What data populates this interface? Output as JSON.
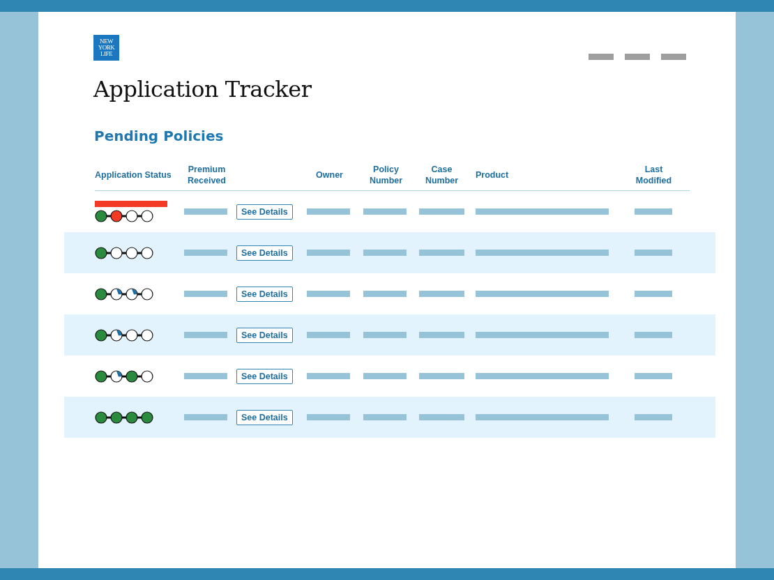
{
  "logo": {
    "lines": [
      "NEW",
      "YORK",
      "LIFE"
    ]
  },
  "title": "Application Tracker",
  "section": "Pending Policies",
  "table": {
    "columns": [
      "Application Status",
      "Premium Received",
      "",
      "Owner",
      "Policy Number",
      "Case Number",
      "Product",
      "Last Modified"
    ],
    "rows": [
      {
        "alert": true,
        "steps": [
          {
            "kind": "done"
          },
          {
            "kind": "error"
          },
          {
            "kind": "pending"
          },
          {
            "kind": "pending"
          }
        ],
        "button": "See Details"
      },
      {
        "alert": false,
        "steps": [
          {
            "kind": "done"
          },
          {
            "kind": "pending"
          },
          {
            "kind": "pending"
          },
          {
            "kind": "pending"
          }
        ],
        "button": "See Details"
      },
      {
        "alert": false,
        "steps": [
          {
            "kind": "done"
          },
          {
            "kind": "partial"
          },
          {
            "kind": "partial"
          },
          {
            "kind": "pending"
          }
        ],
        "button": "See Details"
      },
      {
        "alert": false,
        "steps": [
          {
            "kind": "done"
          },
          {
            "kind": "partial"
          },
          {
            "kind": "pending"
          },
          {
            "kind": "pending"
          }
        ],
        "button": "See Details"
      },
      {
        "alert": false,
        "steps": [
          {
            "kind": "done"
          },
          {
            "kind": "partial"
          },
          {
            "kind": "done"
          },
          {
            "kind": "pending"
          }
        ],
        "button": "See Details"
      },
      {
        "alert": false,
        "steps": [
          {
            "kind": "done"
          },
          {
            "kind": "done"
          },
          {
            "kind": "done"
          },
          {
            "kind": "done"
          }
        ],
        "button": "See Details"
      }
    ]
  }
}
